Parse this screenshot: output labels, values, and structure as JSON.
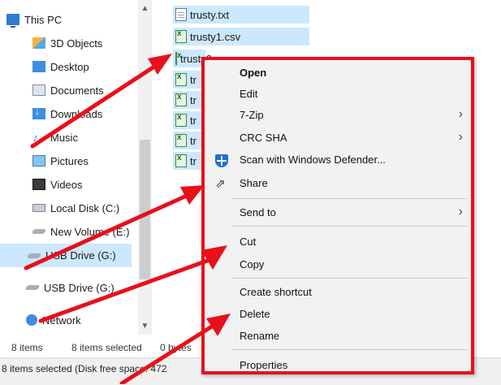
{
  "nav": {
    "items": [
      {
        "label": "This PC",
        "icon": "computer-icon"
      },
      {
        "label": "3D Objects",
        "icon": "cube-icon"
      },
      {
        "label": "Desktop",
        "icon": "desktop-folder-icon"
      },
      {
        "label": "Documents",
        "icon": "documents-icon"
      },
      {
        "label": "Downloads",
        "icon": "downloads-icon"
      },
      {
        "label": "Music",
        "icon": "music-icon"
      },
      {
        "label": "Pictures",
        "icon": "pictures-icon"
      },
      {
        "label": "Videos",
        "icon": "videos-icon"
      },
      {
        "label": "Local Disk (C:)",
        "icon": "disk-icon"
      },
      {
        "label": "New Volume (E:)",
        "icon": "drive-icon"
      },
      {
        "label": "USB Drive (G:)",
        "icon": "usb-drive-icon",
        "selected": true
      },
      {
        "label": "USB Drive (G:)",
        "icon": "usb-drive-icon"
      },
      {
        "label": "Network",
        "icon": "network-icon"
      }
    ]
  },
  "files": [
    {
      "name": "trusty.txt",
      "type": "txt"
    },
    {
      "name": "trusty1.csv",
      "type": "csv"
    },
    {
      "name": "trusty2",
      "type": "csv"
    },
    {
      "name": "tr",
      "type": "csv"
    },
    {
      "name": "tr",
      "type": "csv"
    },
    {
      "name": "tr",
      "type": "csv"
    },
    {
      "name": "tr",
      "type": "csv"
    },
    {
      "name": "tr",
      "type": "csv"
    }
  ],
  "status": {
    "item_count": "8 items",
    "selected": "8 items selected",
    "size": "0 bytes",
    "details": "8 items selected (Disk free space: 472"
  },
  "context_menu": {
    "open": "Open",
    "edit": "Edit",
    "seven_zip": "7-Zip",
    "crc_sha": "CRC SHA",
    "scan": "Scan with Windows Defender...",
    "share": "Share",
    "send_to": "Send to",
    "cut": "Cut",
    "copy": "Copy",
    "create_shortcut": "Create shortcut",
    "delete": "Delete",
    "rename": "Rename",
    "properties": "Properties",
    "submenu_arrow": "›"
  },
  "colors": {
    "selection": "#cce8ff",
    "annotation_red": "#e8101a",
    "menu_background": "#f2f2f2"
  }
}
